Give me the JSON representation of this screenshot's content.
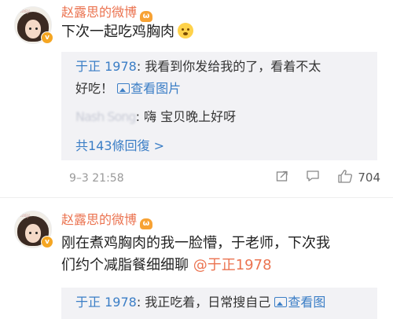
{
  "comments": [
    {
      "name": "赵露思的微博",
      "text": "下次一起吃鸡胸肉",
      "avatar_label": "Rosy",
      "replies": [
        {
          "name": "于正 1978",
          "line1": ": 我看到你发给我的了，看着不太",
          "line2": "好吃！",
          "link": "查看图片"
        },
        {
          "name_blurred": "Nash Song",
          "text": ": 嗨  宝贝晚上好呀"
        }
      ],
      "more": "共143條回復 >",
      "time": "9–3 21:58",
      "likes": "704"
    },
    {
      "name": "赵露思的微博",
      "text_line1": "刚在煮鸡胸肉的我一脸懵，于老师，下次我",
      "text_line2": "们约个减脂餐细细聊 ",
      "mention": "@于正1978",
      "avatar_label": "Rosy",
      "replies": [
        {
          "name": "于正 1978",
          "text": ": 我正吃着，日常搜自己 ",
          "link": "查看图"
        }
      ]
    }
  ],
  "colors": {
    "name": "#eb7350",
    "link": "#3b7ec6",
    "reply_bg": "#f2f2f5"
  },
  "icons": [
    "member-crown-icon",
    "verified-badge-icon",
    "emoji-icon",
    "image-icon",
    "share-icon",
    "comment-icon",
    "like-icon"
  ]
}
